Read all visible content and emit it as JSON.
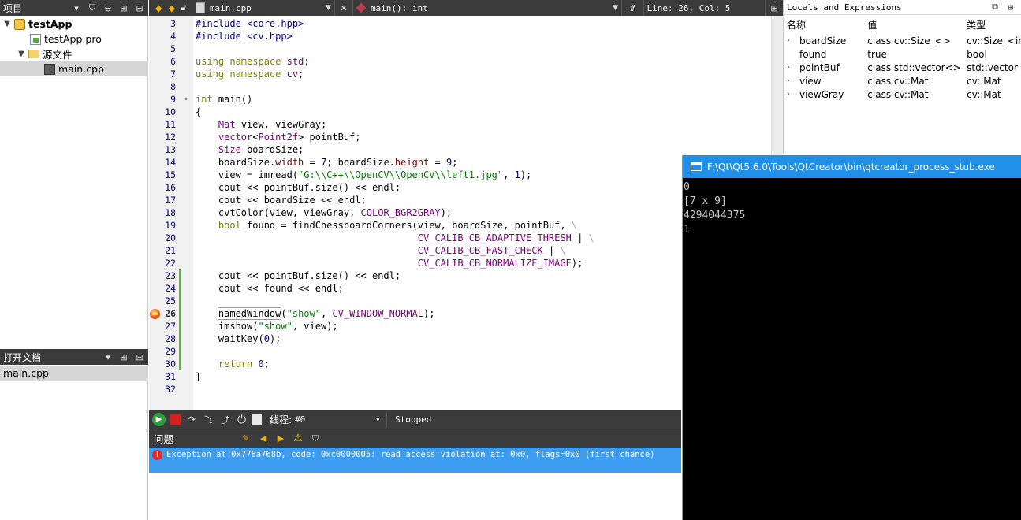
{
  "projects_pane": {
    "title": "项目",
    "tree": [
      {
        "label": "testApp",
        "bold": true,
        "expanded": true
      },
      {
        "label": "testApp.pro"
      },
      {
        "label": "源文件",
        "expanded": true
      },
      {
        "label": "main.cpp",
        "selected": true
      }
    ]
  },
  "open_docs": {
    "title": "打开文档",
    "items": [
      "main.cpp"
    ]
  },
  "editor": {
    "file": "main.cpp",
    "function": "main(): int",
    "hash": "#",
    "position": "Line: 26, Col: 5",
    "current_line": 26,
    "line_numbers": [
      "3",
      "4",
      "5",
      "6",
      "7",
      "8",
      "9",
      "10",
      "11",
      "12",
      "13",
      "14",
      "15",
      "16",
      "17",
      "18",
      "19",
      "20",
      "21",
      "22",
      "23",
      "24",
      "25",
      "26",
      "27",
      "28",
      "29",
      "30",
      "31",
      "32"
    ]
  },
  "debugger": {
    "thread_label": "线程:",
    "thread_value": "#0",
    "status": "Stopped."
  },
  "issues": {
    "title": "问题",
    "message": "Exception at 0x778a768b, code: 0xc0000005: read access violation at: 0x0, flags=0x0 (first chance)"
  },
  "locals": {
    "title": "Locals and Expressions",
    "columns": [
      "名称",
      "值",
      "类型"
    ],
    "rows": [
      {
        "name": "boardSize",
        "value": "class cv::Size_<>",
        "type": "cv::Size_<int>",
        "expandable": true
      },
      {
        "name": "found",
        "value": "true",
        "type": "bool",
        "expandable": false
      },
      {
        "name": "pointBuf",
        "value": "class std::vector<>",
        "type": "std::vector",
        "expandable": true
      },
      {
        "name": "view",
        "value": "class cv::Mat",
        "type": "cv::Mat",
        "expandable": true
      },
      {
        "name": "viewGray",
        "value": "class cv::Mat",
        "type": "cv::Mat",
        "expandable": true
      }
    ]
  },
  "console": {
    "title": "F:\\Qt\\Qt5.6.0\\Tools\\QtCreator\\bin\\qtcreator_process_stub.exe",
    "lines": [
      "0",
      "[7 x 9]",
      "4294044375",
      "1"
    ]
  },
  "colors": {
    "toolbar": "#3b3b3b",
    "issue_highlight": "#3b9cf0",
    "console_title": "#1f8fe8",
    "keyword": "#808000",
    "type": "#800080",
    "string": "#008000"
  }
}
